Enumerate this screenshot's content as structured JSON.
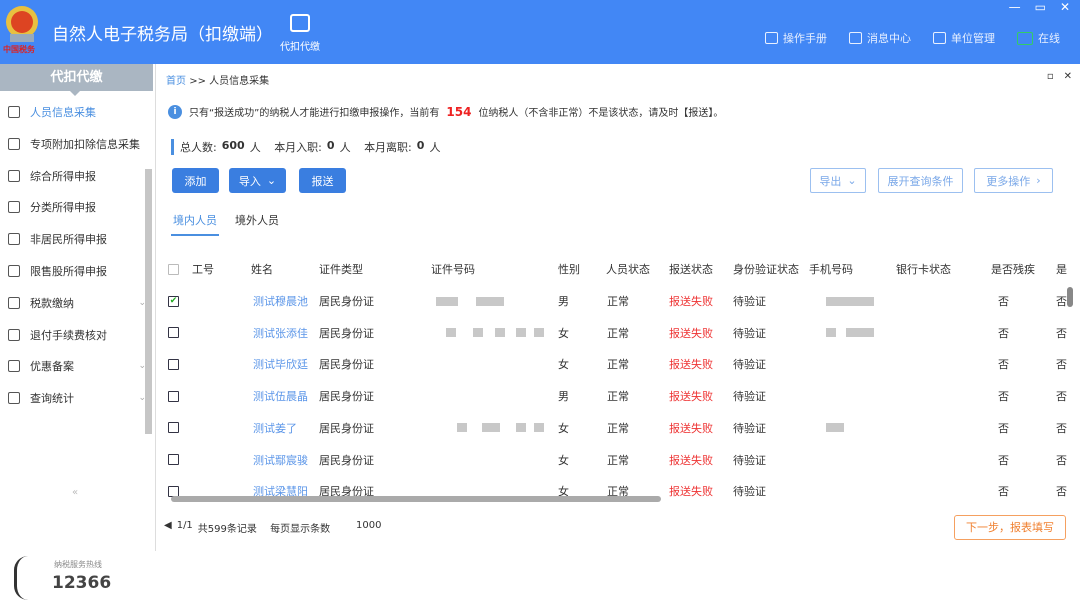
{
  "header": {
    "logo_text": "中国税务",
    "title": "自然人电子税务局（扣缴端）",
    "top_tab": "代扣代缴",
    "links": [
      {
        "icon": "document-icon",
        "label": "操作手册"
      },
      {
        "icon": "mail-icon",
        "label": "消息中心"
      },
      {
        "icon": "building-icon",
        "label": "单位管理"
      },
      {
        "icon": "monitor-check-icon",
        "label": "在线"
      }
    ],
    "window": {
      "min": "—",
      "max": "▭",
      "close": "✕"
    }
  },
  "sidebar": {
    "title": "代扣代缴",
    "items": [
      {
        "label": "人员信息采集",
        "icon": "user-add-icon",
        "active": true
      },
      {
        "label": "专项附加扣除信息采集",
        "icon": "list-icon"
      },
      {
        "label": "综合所得申报",
        "icon": "layers-icon"
      },
      {
        "label": "分类所得申报",
        "icon": "pie-icon"
      },
      {
        "label": "非居民所得申报",
        "icon": "user-icon"
      },
      {
        "label": "限售股所得申报",
        "icon": "bar-chart-icon"
      },
      {
        "label": "税款缴纳",
        "icon": "folder-icon",
        "expand": true
      },
      {
        "label": "退付手续费核对",
        "icon": "checklist-icon"
      },
      {
        "label": "优惠备案",
        "icon": "file-icon",
        "expand": true
      },
      {
        "label": "查询统计",
        "icon": "search-list-icon",
        "expand": true
      }
    ],
    "collapse": "«",
    "hotline_label": "纳税服务热线",
    "hotline": "12366"
  },
  "breadcrumb": {
    "home": "首页",
    "sep": ">>",
    "current": "人员信息采集"
  },
  "info": {
    "pre": "只有“报送成功”的纳税人才能进行扣缴申报操作，当前有",
    "count": "154",
    "post": "位纳税人（不含非正常）不是该状态，请及时【报送】。"
  },
  "stats": {
    "total_label": "总人数:",
    "total": "600",
    "unit": "人",
    "join_label": "本月入职:",
    "join": "0",
    "leave_label": "本月离职:",
    "leave": "0"
  },
  "buttons": {
    "add": "添加",
    "import": "导入",
    "submit": "报送",
    "export": "导出",
    "expand_query": "展开查询条件",
    "more": "更多操作"
  },
  "tabs": [
    "境内人员",
    "境外人员"
  ],
  "table": {
    "headers": [
      "工号",
      "姓名",
      "证件类型",
      "证件号码",
      "性别",
      "人员状态",
      "报送状态",
      "身份验证状态",
      "手机号码",
      "银行卡状态",
      "是否残疾",
      "是"
    ],
    "rows": [
      {
        "checked": true,
        "name": "测试穆晨池",
        "id_type": "居民身份证",
        "gender": "男",
        "status": "正常",
        "report": "报送失败",
        "verify": "待验证",
        "disabled": "否",
        "last": "否"
      },
      {
        "checked": false,
        "name": "测试张添佳",
        "id_type": "居民身份证",
        "gender": "女",
        "status": "正常",
        "report": "报送失败",
        "verify": "待验证",
        "disabled": "否",
        "last": "否"
      },
      {
        "checked": false,
        "name": "测试毕欣廷",
        "id_type": "居民身份证",
        "gender": "女",
        "status": "正常",
        "report": "报送失败",
        "verify": "待验证",
        "disabled": "否",
        "last": "否"
      },
      {
        "checked": false,
        "name": "测试伍晨晶",
        "id_type": "居民身份证",
        "gender": "男",
        "status": "正常",
        "report": "报送失败",
        "verify": "待验证",
        "disabled": "否",
        "last": "否"
      },
      {
        "checked": false,
        "name": "测试姜了",
        "id_type": "居民身份证",
        "gender": "女",
        "status": "正常",
        "report": "报送失败",
        "verify": "待验证",
        "disabled": "否",
        "last": "否"
      },
      {
        "checked": false,
        "name": "测试鄢宸骏",
        "id_type": "居民身份证",
        "gender": "女",
        "status": "正常",
        "report": "报送失败",
        "verify": "待验证",
        "disabled": "否",
        "last": "否"
      },
      {
        "checked": false,
        "name": "测试梁慧阳",
        "id_type": "居民身份证",
        "gender": "女",
        "status": "正常",
        "report": "报送失败",
        "verify": "待验证",
        "disabled": "否",
        "last": "否"
      }
    ]
  },
  "pager": {
    "prev": "◀",
    "page": "1/1",
    "next": "▶",
    "total": "共599条记录",
    "per_page_label": "每页显示条数",
    "per_page": "1000"
  },
  "next_button": "下一步，报表填写",
  "colors": {
    "header": "#4287f5",
    "accent": "#3a7ee0",
    "fail": "#e33333",
    "next": "#f08030"
  }
}
